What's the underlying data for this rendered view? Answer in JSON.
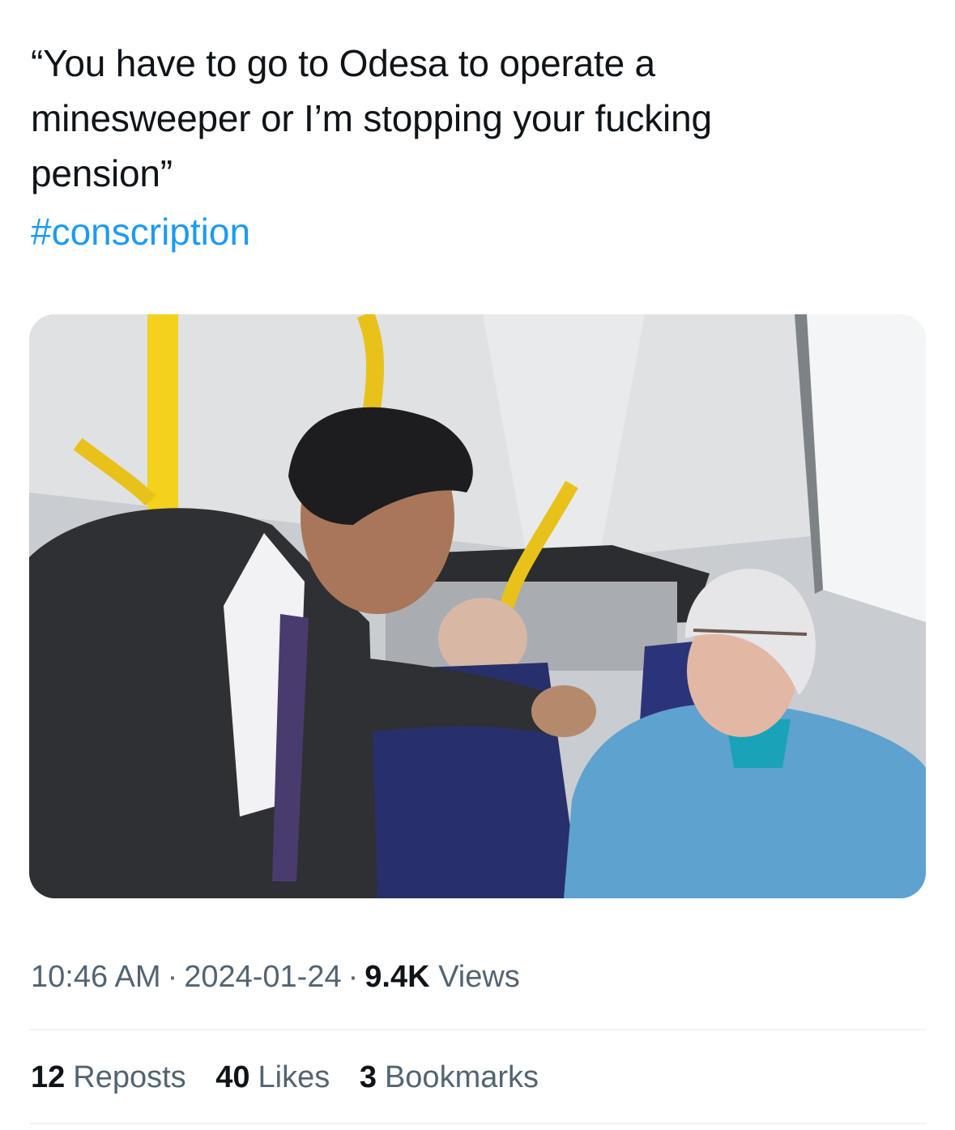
{
  "tweet": {
    "text_lines": [
      "“You have to go to Odesa to operate a",
      "minesweeper or I’m stopping your fucking",
      "pension”"
    ],
    "hashtag": "#conscription"
  },
  "media": {
    "alt": "Photo: man in a suit leaning toward an elderly woman seated on a bus"
  },
  "meta": {
    "time": "10:46 AM",
    "separator": "·",
    "date": "2024-01-24",
    "views_count": "9.4K",
    "views_label": "Views"
  },
  "stats": {
    "reposts_count": "12",
    "reposts_label": "Reposts",
    "likes_count": "40",
    "likes_label": "Likes",
    "bookmarks_count": "3",
    "bookmarks_label": "Bookmarks"
  },
  "colors": {
    "link": "#1d9bf0",
    "text_primary": "#0f1419",
    "text_secondary": "#536471",
    "divider": "#eff3f4"
  }
}
